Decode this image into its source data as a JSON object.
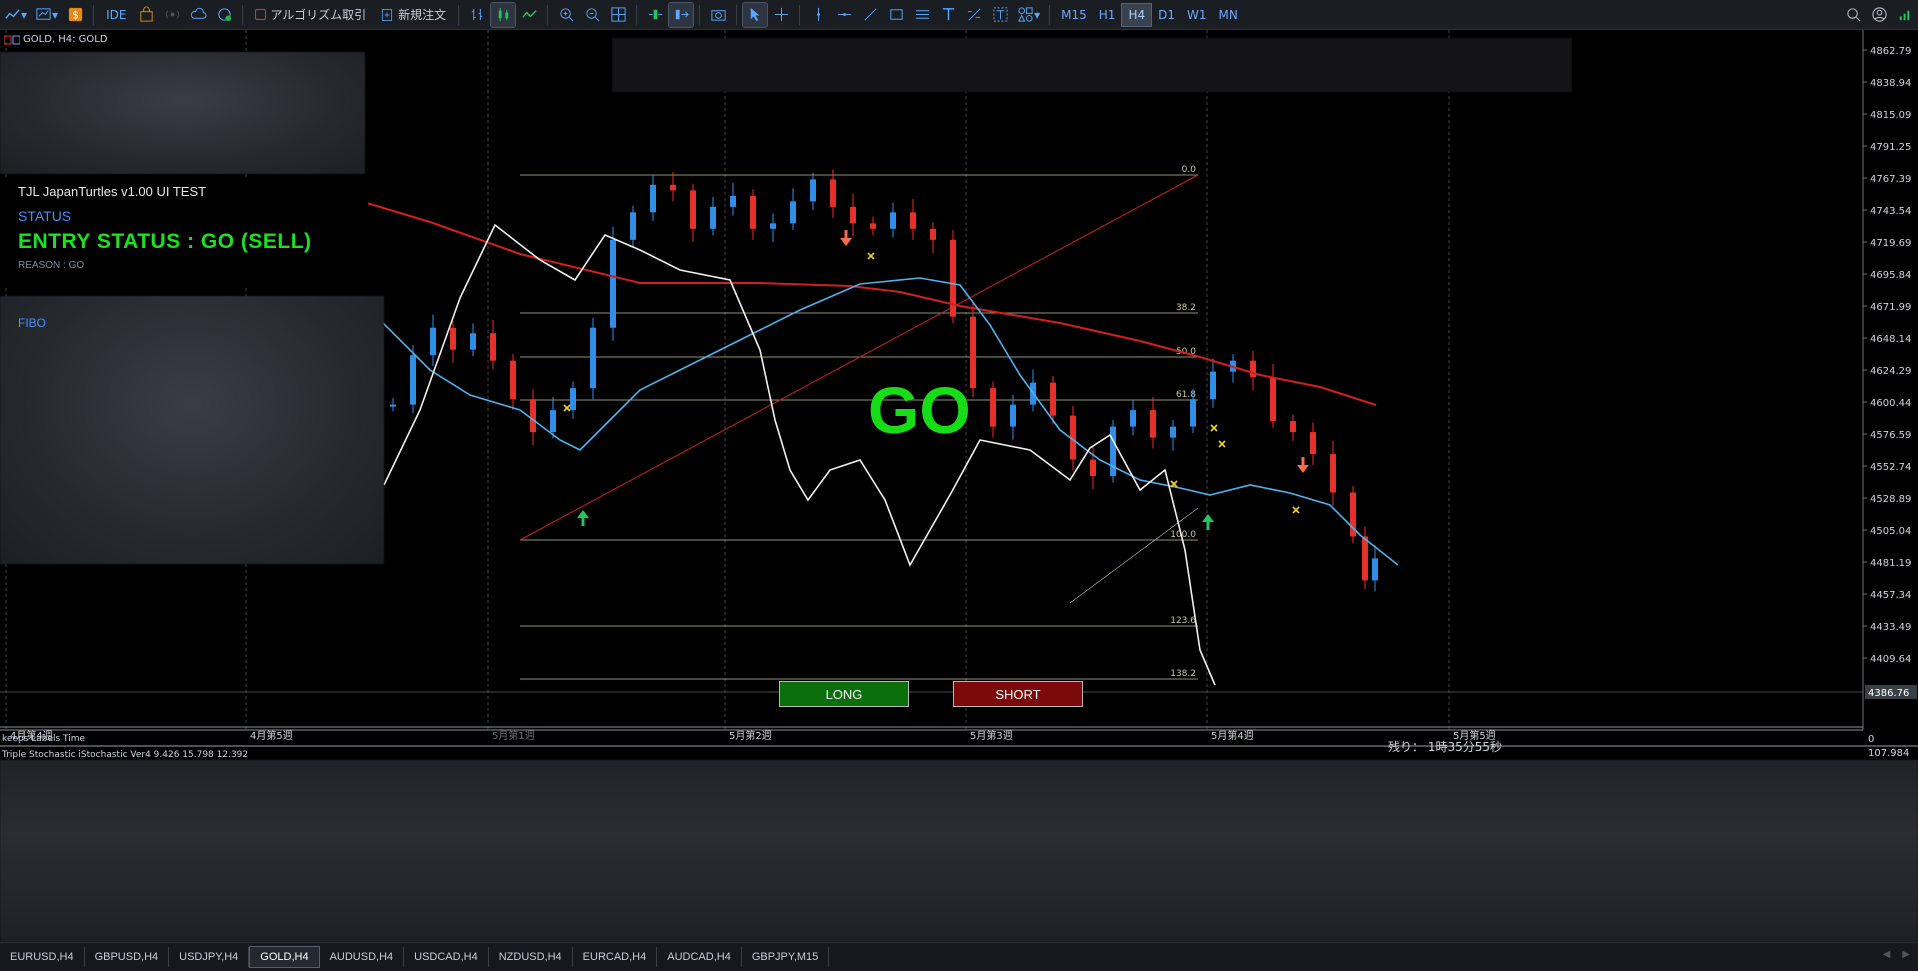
{
  "toolbar": {
    "ide": "IDE",
    "algo_trading": "アルゴリズム取引",
    "new_order": "新規注文",
    "timeframes": [
      "M15",
      "H1",
      "H4",
      "D1",
      "W1",
      "MN"
    ],
    "active_timeframe": "H4"
  },
  "chart": {
    "symbol_label": "GOLD, H4:  GOLD",
    "price_labels": [
      "4862.79",
      "4838.94",
      "4815.09",
      "4791.25",
      "4767.39",
      "4743.54",
      "4719.69",
      "4695.84",
      "4671.99",
      "4648.14",
      "4624.29",
      "4600.44",
      "4576.59",
      "4552.74",
      "4528.89",
      "4505.04",
      "4481.19",
      "4457.34",
      "4433.49",
      "4409.64"
    ],
    "current_price": "4386.76",
    "time_labels": [
      "4月第4週",
      "4月第5週",
      "5月第1週",
      "5月第2週",
      "5月第3週",
      "5月第4週",
      "5月第5週"
    ],
    "left_label": "keeps Labels Time",
    "fib_levels": [
      "0.0",
      "38.2",
      "50.0",
      "61.8",
      "100.0",
      "123.6",
      "138.2"
    ],
    "go_text": "GO",
    "remaining_label": "残り：",
    "remaining_value": "1時35分55秒",
    "long_button": "LONG",
    "short_button": "SHORT",
    "subwindow_label": "Triple Stochastic iStochastic Ver4 9.426 15.798 12.392",
    "subwindow_value": "107.984",
    "subwindow_top": "0",
    "colors": {
      "bull": "#2f8fe8",
      "bear": "#e8302a",
      "ma_blue": "#4fb3f0",
      "ma_red": "#d2201f",
      "fib": "#c8c79a",
      "go": "#17dd17"
    }
  },
  "panel": {
    "title": "TJL JapanTurtles v1.00 UI TEST",
    "status_label": "STATUS",
    "entry_status": "ENTRY STATUS : GO (SELL)",
    "reason": "REASON : GO",
    "fibo_label": "FIBO"
  },
  "symbol_tabs": [
    "EURUSD,H4",
    "GBPUSD,H4",
    "USDJPY,H4",
    "GOLD,H4",
    "AUDUSD,H4",
    "USDCAD,H4",
    "NZDUSD,H4",
    "EURCAD,H4",
    "AUDCAD,H4",
    "GBPJPY,M15"
  ],
  "active_tab": "GOLD,H4"
}
